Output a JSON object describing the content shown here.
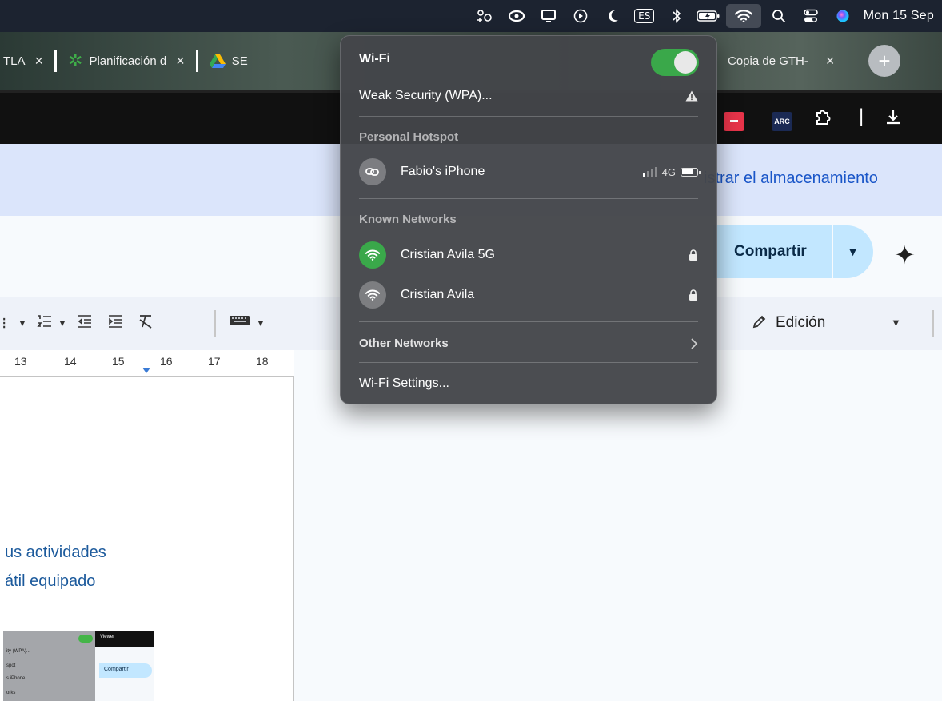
{
  "menubar": {
    "input_source": "ES",
    "clock": "Mon 15 Sep",
    "icons": [
      "extension-icon",
      "creative-cloud-icon",
      "display-icon",
      "play-icon",
      "moon-icon",
      "input-source-icon",
      "bluetooth-icon",
      "battery-icon",
      "wifi-icon",
      "search-icon",
      "control-center-icon",
      "siri-icon"
    ]
  },
  "tabs": [
    {
      "label": "TLA"
    },
    {
      "label": "Planificación d"
    },
    {
      "label": "SE"
    },
    {
      "label": "Copia de GTH-"
    }
  ],
  "banner": {
    "text": "istrar el almacenamiento"
  },
  "docs": {
    "share_label": "Compartir",
    "mode_label": "Edición"
  },
  "ruler": {
    "ticks": [
      "13",
      "14",
      "15",
      "16",
      "17",
      "18"
    ]
  },
  "document": {
    "line1": "us actividades",
    "line2": "átil equipado",
    "thumb": {
      "line1": "ity (WPA)...",
      "line2": "spot",
      "line3": "s iPhone",
      "line4": "orks",
      "header": "Viewer",
      "share": "Compartir"
    }
  },
  "wifi_panel": {
    "title": "Wi-Fi",
    "enabled": true,
    "current_network": "Weak Security (WPA)...",
    "hotspot_header": "Personal Hotspot",
    "hotspot": {
      "name": "Fabio's iPhone",
      "network_type": "4G"
    },
    "known_header": "Known Networks",
    "known_networks": [
      {
        "name": "Cristian Avila 5G",
        "connected": true
      },
      {
        "name": "Cristian Avila",
        "connected": false
      }
    ],
    "other_networks": "Other Networks",
    "settings": "Wi-Fi Settings...",
    "accent_color": "#3aa84a"
  }
}
